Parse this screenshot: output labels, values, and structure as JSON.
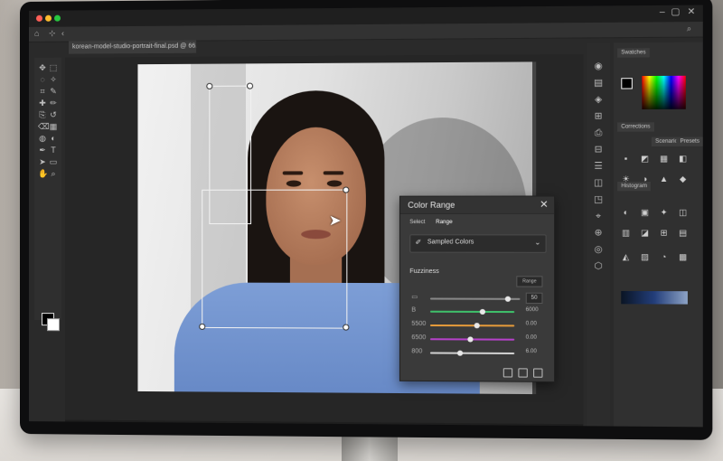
{
  "document": {
    "tab_title": "korean-model-studio-portrait-final.psd @ 66.7% (RGB/8) *"
  },
  "toolbar": {
    "tools": [
      "move-tool",
      "marquee-tool",
      "lasso-tool",
      "quick-select-tool",
      "crop-tool",
      "eyedropper-tool",
      "healing-tool",
      "brush-tool",
      "clone-stamp-tool",
      "history-brush-tool",
      "eraser-tool",
      "gradient-tool",
      "blur-tool",
      "dodge-tool",
      "pen-tool",
      "type-tool",
      "path-select-tool",
      "shape-tool",
      "hand-tool",
      "zoom-tool"
    ]
  },
  "right_panels": {
    "color_tab": "Swatches",
    "adjustments_tab": "Corrections",
    "properties_tab": "Histogram",
    "tab_a": "Scenarios",
    "tab_b": "Presets"
  },
  "color_range_dialog": {
    "title": "Color Range",
    "tab_select": "Select",
    "tab_range": "Range",
    "select_value": "Sampled Colors",
    "fuzziness_label": "Fuzziness",
    "reset_label": "Range",
    "fuzziness_value": "50",
    "sliders": [
      {
        "label": "B",
        "value_text": "6000",
        "color": "#3fbf6a",
        "position": 0.62
      },
      {
        "label": "5500",
        "value_text": "0.00",
        "color": "#e49a3a",
        "position": 0.55
      },
      {
        "label": "6500",
        "value_text": "0.00",
        "color": "#b541c9",
        "position": 0.48
      },
      {
        "label": "800",
        "value_text": "6.00",
        "color": "#cfcfcf",
        "position": 0.36
      }
    ],
    "fuzziness_position": 0.86
  },
  "colors": {
    "accent": "#3d8ee6",
    "shirt": "#7193cf"
  }
}
